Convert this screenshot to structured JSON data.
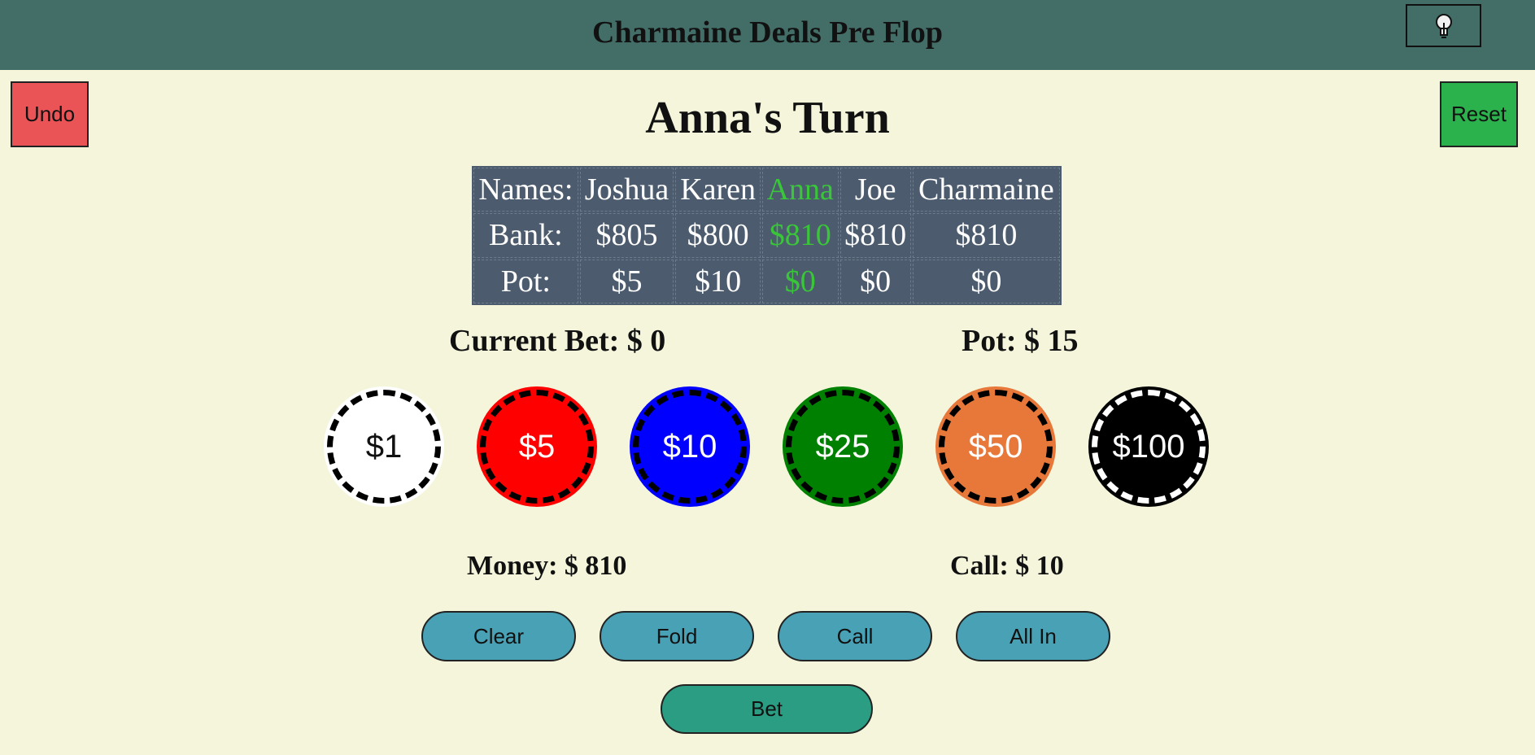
{
  "header": {
    "title": "Charmaine Deals Pre Flop",
    "hint_icon": "lightbulb-icon"
  },
  "controls": {
    "undo_label": "Undo",
    "reset_label": "Reset"
  },
  "turn": {
    "title": "Anna's Turn"
  },
  "table": {
    "row_labels": {
      "names": "Names:",
      "bank": "Bank:",
      "pot": "Pot:"
    },
    "active_player_index": 2,
    "active_color": "#39c739",
    "players": [
      {
        "name": "Joshua",
        "bank": "$805",
        "pot": "$5"
      },
      {
        "name": "Karen",
        "bank": "$800",
        "pot": "$10"
      },
      {
        "name": "Anna",
        "bank": "$810",
        "pot": "$0"
      },
      {
        "name": "Joe",
        "bank": "$810",
        "pot": "$0"
      },
      {
        "name": "Charmaine",
        "bank": "$810",
        "pot": "$0"
      }
    ]
  },
  "bet_info": {
    "current_bet": "Current Bet: $ 0",
    "pot": "Pot: $ 15",
    "money": "Money: $ 810",
    "call": "Call: $ 10"
  },
  "chips": [
    {
      "label": "$1",
      "color": "#ffffff",
      "dash": "#000000",
      "text_color": "#111111"
    },
    {
      "label": "$5",
      "color": "#ff0000",
      "dash": "#000000",
      "text_color": "#ffffff"
    },
    {
      "label": "$10",
      "color": "#0000ff",
      "dash": "#000000",
      "text_color": "#ffffff"
    },
    {
      "label": "$25",
      "color": "#008000",
      "dash": "#000000",
      "text_color": "#ffffff"
    },
    {
      "label": "$50",
      "color": "#e8783a",
      "dash": "#000000",
      "text_color": "#ffffff"
    },
    {
      "label": "$100",
      "color": "#000000",
      "dash": "#ffffff",
      "text_color": "#ffffff"
    }
  ],
  "actions": {
    "clear": "Clear",
    "fold": "Fold",
    "call": "Call",
    "all_in": "All In",
    "bet": "Bet"
  }
}
